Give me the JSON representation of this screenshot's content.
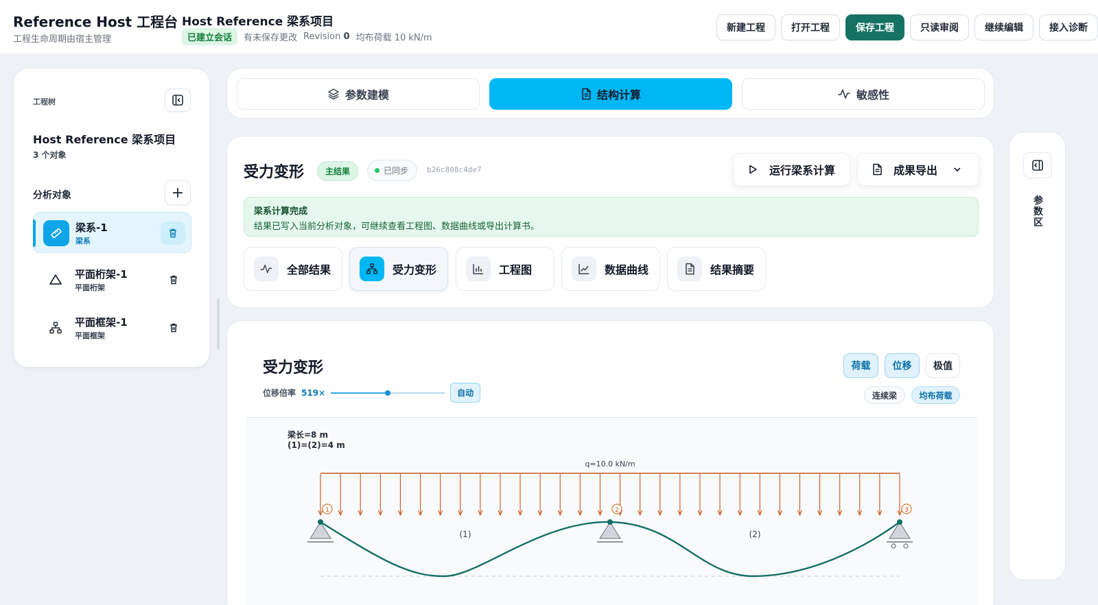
{
  "header": {
    "app_title": "Reference Host 工程台",
    "app_subtitle": "工程生命周期由宿主管理",
    "project_title": "Host Reference 梁系项目",
    "session_badge": "已建立会话",
    "unsaved": "有未保存更改",
    "revision_label": "Revision",
    "revision_value": "0",
    "load_info": "均布荷载 10 kN/m",
    "actions": [
      "新建工程",
      "打开工程",
      "保存工程",
      "只读审阅",
      "继续编辑",
      "接入诊断"
    ]
  },
  "sidebar": {
    "caption": "工程树",
    "project_name": "Host Reference 梁系项目",
    "object_count": "3 个对象",
    "objects_label": "分析对象",
    "add_icon": "plus-icon",
    "items": [
      {
        "name": "梁系-1",
        "type": "梁系",
        "icon": "ruler-icon"
      },
      {
        "name": "平面桁架-1",
        "type": "平面桁架",
        "icon": "triangle-icon"
      },
      {
        "name": "平面框架-1",
        "type": "平面框架",
        "icon": "frame-icon"
      }
    ]
  },
  "tabs": [
    {
      "label": "参数建模",
      "icon": "layers-icon"
    },
    {
      "label": "结构计算",
      "icon": "document-icon"
    },
    {
      "label": "敏感性",
      "icon": "pulse-icon"
    }
  ],
  "section": {
    "title": "受力变形",
    "main_badge": "主结果",
    "sync_badge": "已同步",
    "hash": "b26c808c4de7",
    "run_button": "运行梁系计算",
    "export_button": "成果导出",
    "alert_title": "梁系计算完成",
    "alert_text": "结果已写入当前分析对象，可继续查看工程图、数据曲线或导出计算书。",
    "result_tabs": [
      {
        "label": "全部结果",
        "icon": "pulse-icon"
      },
      {
        "label": "受力变形",
        "icon": "frame-icon"
      },
      {
        "label": "工程图",
        "icon": "bar-chart-icon"
      },
      {
        "label": "数据曲线",
        "icon": "line-chart-icon"
      },
      {
        "label": "结果摘要",
        "icon": "document-icon"
      }
    ]
  },
  "figure": {
    "title": "受力变形",
    "scale_label": "位移倍率",
    "scale_value": "519×",
    "scale_fraction": 0.5,
    "auto_label": "自动",
    "toggles": [
      "荷载",
      "位移",
      "极值"
    ],
    "chips": [
      "连续梁",
      "均布荷载"
    ],
    "beam_length": "梁长=8 m",
    "spans": "(1)=(2)=4 m",
    "load_label": "q=10.0 kN/m",
    "nodes": [
      "1",
      "2",
      "3"
    ],
    "elements": [
      "(1)",
      "(2)"
    ]
  },
  "right_rail": {
    "label": "参数区"
  },
  "colors": {
    "accent": "#00b7f5",
    "primary": "#157262",
    "load": "#c8541a",
    "deflection": "#137067"
  }
}
